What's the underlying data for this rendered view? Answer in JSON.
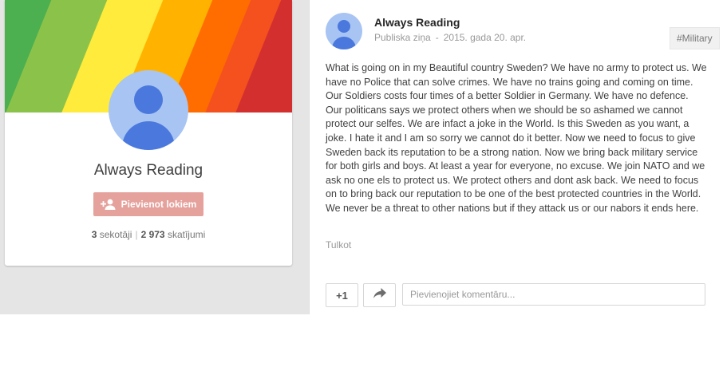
{
  "profile": {
    "name": "Always Reading",
    "follow_label": "Pievienot lokiem",
    "followers_count": "3",
    "followers_label": "sekotāji",
    "views_count": "2 973",
    "views_label": "skatījumi",
    "cover_colors": [
      "#4caf50",
      "#8bc34a",
      "#ffeb3b",
      "#ffb300",
      "#ff6d00",
      "#f4511e",
      "#d32f2f"
    ]
  },
  "post": {
    "author": "Always Reading",
    "visibility": "Publiska ziņa",
    "separator": "-",
    "date": "2015. gada 20. apr.",
    "tag": "#Military",
    "text": "What is going on in my Beautiful country Sweden? We have no army to protect us. We have no Police that can solve crimes. We have no trains going and coming on time. Our Soldiers costs four times of a better Soldier in Germany. We have no defence. Our politicans says we protect others when we should be so ashamed we cannot protect our selfes. We are infact a joke in the World. Is this Sweden as you want, a joke. I hate it and I am so sorry we cannot do it better. Now we need to focus to give Sweden back its reputation to be a strong nation. Now we bring back military service for both girls and boys. At least a year for everyone, no excuse. We join NATO and we ask no one els to protect us. We protect others and dont ask back. We need to focus on to bring back our reputation to be one of the best protected  countries in the World. We never be a threat to other nations but if they attack us or our nabors it ends here.",
    "translate_label": "Tulkot",
    "plus_one_label": "+1",
    "comment_placeholder": "Pievienojiet komentāru...",
    "comment_value": ""
  },
  "icons": {
    "avatar": "person-avatar-icon",
    "add_person": "add-person-icon",
    "share": "share-arrow-icon"
  },
  "colors": {
    "follow_button": "#e5a19c",
    "avatar_bg": "#a7c4f3",
    "avatar_fg": "#4a78dd",
    "page_bg": "#e5e5e5"
  }
}
